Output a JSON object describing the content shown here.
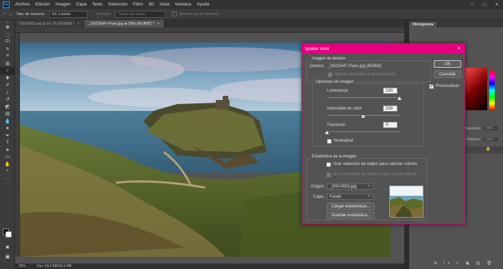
{
  "menubar": {
    "logo": "Ps",
    "items": [
      "Archivo",
      "Edición",
      "Imagen",
      "Capa",
      "Texto",
      "Selección",
      "Filtro",
      "3D",
      "Vista",
      "Ventana",
      "Ayuda"
    ]
  },
  "options": {
    "sample_size_label": "Tam. de muestra:",
    "sample_size_value": "De 1 punto",
    "sample_label": "Muestra:",
    "sample_value": "Todas las capas",
    "show_ring_label": "Mostrar aro de muestra"
  },
  "tabs": [
    {
      "label": "DSC4553.jpg al 16,7% (RGB/8) *",
      "close": "×"
    },
    {
      "label": "_DSC5547-Pano.jpg al 25% (RGB/8*) *",
      "close": "×"
    }
  ],
  "status": {
    "zoom": "25%",
    "doc": "Doc: 66,0 MB/66,0 MB"
  },
  "right_panel": {
    "histogram_tab": "Histograma",
    "opacity_label": "Opacidad:",
    "opacity_value": "100%",
    "fill_label": "Relleno:",
    "fill_value": "100%"
  },
  "dialog": {
    "title": "Igualar color",
    "close": "×",
    "dest_group": "Imagen de destino",
    "dest_label": "Destino:",
    "dest_value": "_DSC5547-Pano.jpg (RGB/8)",
    "ignore_selection": "Ignorar selección al aplicar ajuste",
    "options_group": "Opciones de imagen",
    "luminance_label": "Luminancia",
    "luminance_value": "100",
    "intensity_label": "Intensidad de color",
    "intensity_value": "100",
    "fade_label": "Transición",
    "fade_value": "0",
    "neutralize_label": "Neutralizar",
    "stats_group": "Estadística de la imagen",
    "use_source_sel": "Usar selección de origen para calcular colores",
    "use_dest_sel": "Usar selección de destino para calcular ajuste",
    "source_label": "Origen:",
    "source_value": "_DSC4553.jpg",
    "layer_label": "Capa:",
    "layer_value": "Fondo",
    "load_stats": "Cargar estadísticas...",
    "save_stats": "Guardar estadística...",
    "ok": "OK",
    "cancel": "Cancelar",
    "preview": "Previsualizar",
    "luminance_level": 1.0,
    "intensity_level": 0.5,
    "fade_level": 0.0
  },
  "colors": {
    "dialog_title_bar": "#e5007e",
    "app_bg": "#535353"
  }
}
